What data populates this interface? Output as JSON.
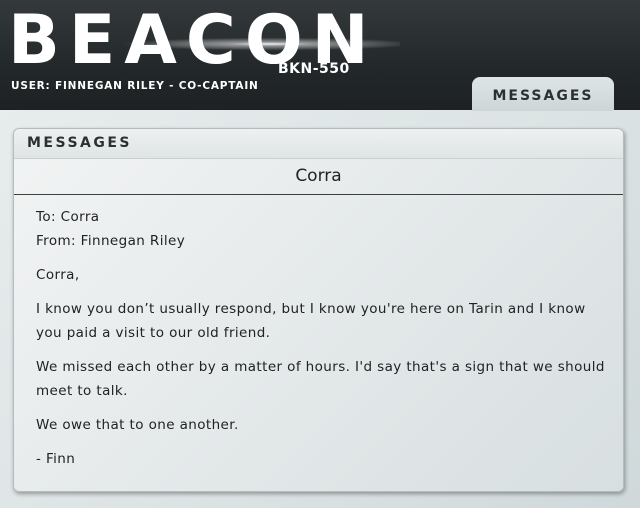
{
  "app": {
    "title": "BEACON",
    "ship_id": "BKN-550",
    "user_line": "USER: FINNEGAN RILEY - CO-CAPTAIN"
  },
  "nav": {
    "tabs": [
      {
        "label": "MESSAGES",
        "active": true
      }
    ]
  },
  "panel": {
    "title": "MESSAGES",
    "recipient": "Corra"
  },
  "message": {
    "to": "To: Corra",
    "from": "From: Finnegan Riley",
    "greeting": "Corra,",
    "paragraphs": [
      "I know you don’t usually respond, but I know you're here on Tarin and I know you paid a visit to our old friend.",
      "We missed each other by a matter of hours. I'd say that's a sign that we should meet to talk.",
      "We owe that to one another."
    ],
    "signature": "- Finn"
  },
  "colors": {
    "header_bg": "#23282a",
    "panel_bg": "#e3e8e9",
    "text": "#222222"
  }
}
